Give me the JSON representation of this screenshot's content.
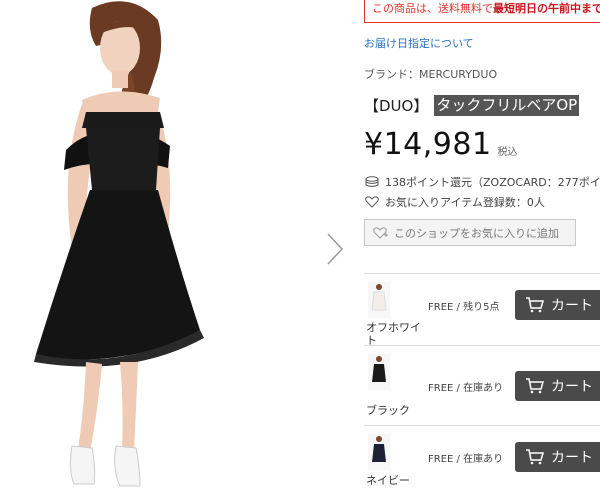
{
  "promo_banner": {
    "pre": "この商品は、送料無料で",
    "bold": "最短明日の午前中まで"
  },
  "delivery_link": "お届け日指定について",
  "brand_label": "ブランド：MERCURYDUO",
  "product": {
    "tag": "【DUO】",
    "name": "タックフリルベアOP",
    "price": "¥14,981",
    "tax": "税込"
  },
  "points_text": "138ポイント還元（ZOZOCARD：277ポイ",
  "favorite_count_text": "お気に入りアイテム登録数：0人",
  "shop_favorite_button": "このショップをお気に入りに追加",
  "skus": [
    {
      "color": "オフホワイト",
      "stock": "FREE / 残り5点",
      "cart_label": "カート"
    },
    {
      "color": "ブラック",
      "stock": "FREE / 在庫あり",
      "cart_label": "カート"
    },
    {
      "color": "ネイビー",
      "stock": "FREE / 在庫あり",
      "cart_label": "カート"
    }
  ],
  "colors": {
    "accent_red": "#e2372c",
    "link_blue": "#2a73c4",
    "cart_bg": "#4a4a4a"
  },
  "icons": [
    "chevron-right-icon",
    "coin-icon",
    "heart-icon",
    "heart-plus-icon",
    "cart-icon"
  ]
}
